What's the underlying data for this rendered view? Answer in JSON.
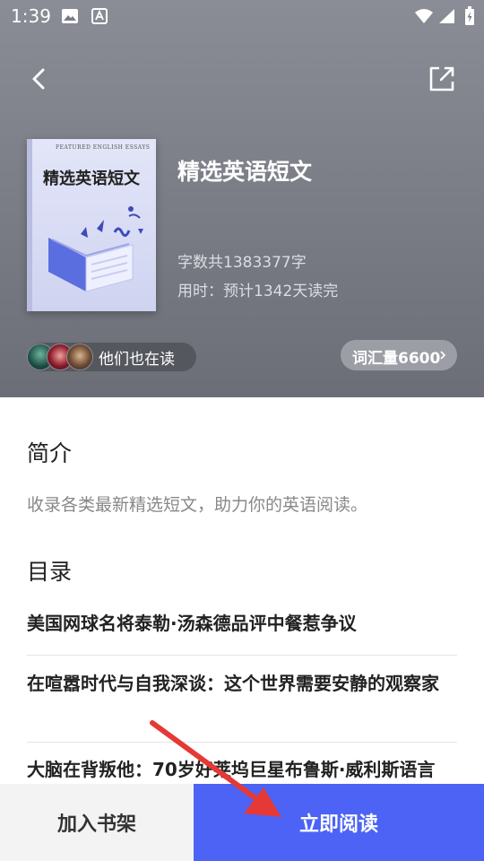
{
  "status_bar": {
    "time": "1:39",
    "icons": [
      "image-icon",
      "font-icon",
      "wifi-icon",
      "signal-icon",
      "battery-icon"
    ]
  },
  "nav": {
    "back_icon": "chevron-left-icon",
    "share_icon": "share-icon"
  },
  "book": {
    "cover_small_text": "FEATURED ENGLISH ESSAYS",
    "cover_title": "精选英语短文",
    "title": "精选英语短文",
    "word_count": "字数共1383377字",
    "time_estimate": "用时：预计1342天读完"
  },
  "readers": {
    "label": "他们也在读"
  },
  "vocab": {
    "label": "词汇量6600"
  },
  "intro": {
    "heading": "简介",
    "text": "收录各类最新精选短文，助力你的英语阅读。"
  },
  "toc": {
    "heading": "目录",
    "items": [
      "美国网球名将泰勒·汤森德品评中餐惹争议",
      "在喧嚣时代与自我深谈：这个世界需要安静的观察家",
      "大脑在背叛他：70岁好莱坞巨星布鲁斯·威利斯语言"
    ]
  },
  "bottom": {
    "add_shelf": "加入书架",
    "read_now": "立即阅读"
  },
  "colors": {
    "header_bg": "#7a7c85",
    "primary_button": "#4c63f5",
    "annotation_arrow": "#e53935"
  }
}
